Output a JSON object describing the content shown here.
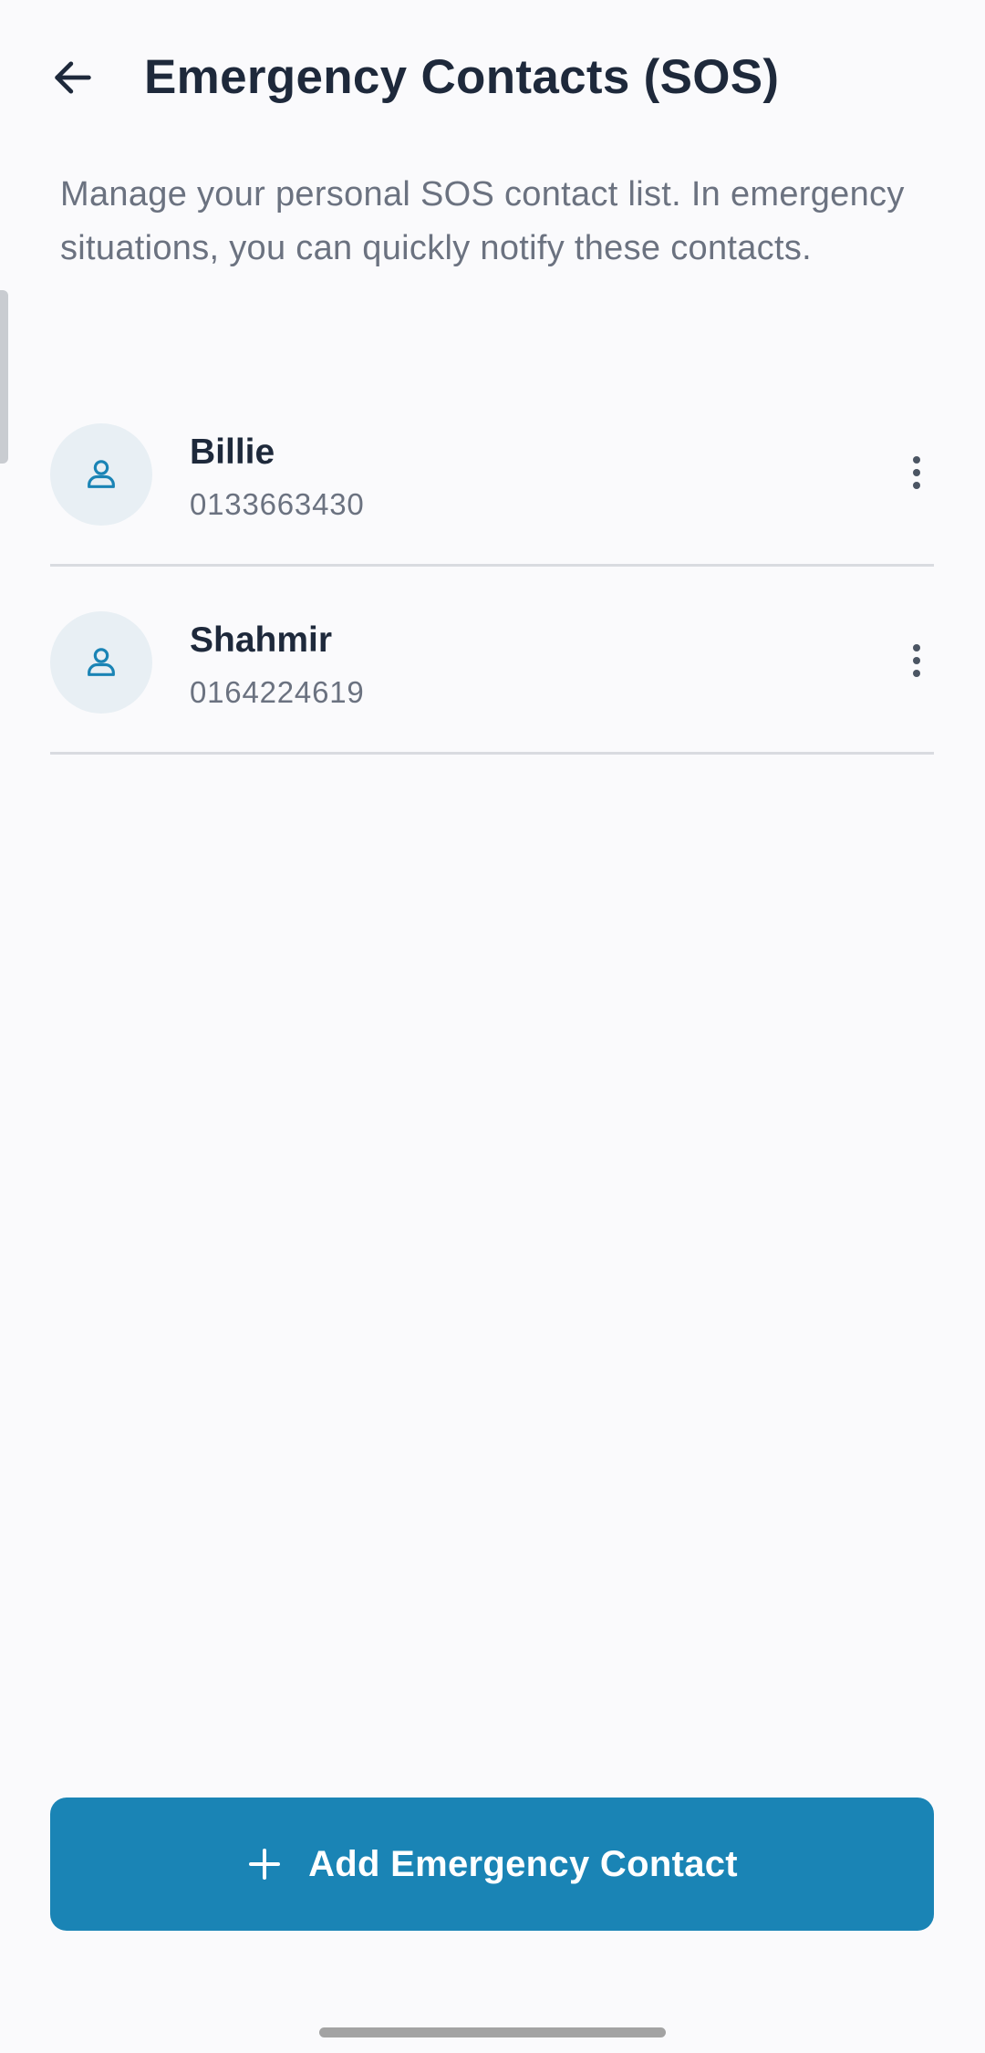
{
  "header": {
    "title": "Emergency Contacts (SOS)",
    "back_icon": "arrow-left-icon"
  },
  "description": "Manage your personal SOS contact list. In emergency situations, you can quickly notify these contacts.",
  "contacts": [
    {
      "name": "Billie",
      "phone": "0133663430",
      "avatar_icon": "person-icon",
      "menu_icon": "more-vertical-icon"
    },
    {
      "name": "Shahmir",
      "phone": "0164224619",
      "avatar_icon": "person-icon",
      "menu_icon": "more-vertical-icon"
    }
  ],
  "add_button": {
    "label": "Add Emergency Contact",
    "icon": "plus-icon"
  },
  "colors": {
    "background": "#fafafc",
    "primary": "#1a84b5",
    "title_text": "#1e293b",
    "secondary_text": "#6b7280",
    "avatar_bg": "#e8eff4",
    "divider": "#d9dbe0"
  }
}
